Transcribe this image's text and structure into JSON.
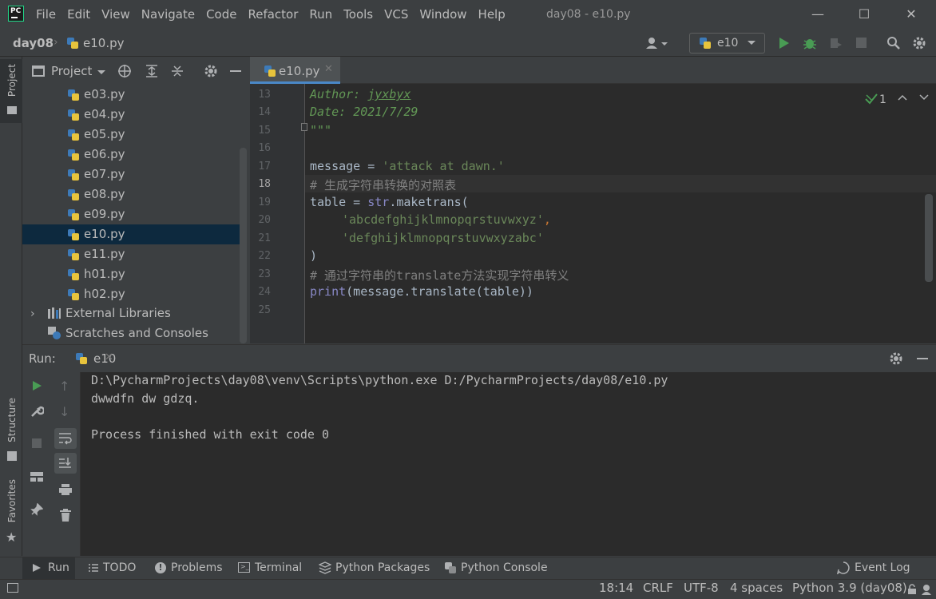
{
  "app": {
    "logo_text": "PC",
    "window_title": "day08 - e10.py",
    "menu": [
      "File",
      "Edit",
      "View",
      "Navigate",
      "Code",
      "Refactor",
      "Run",
      "Tools",
      "VCS",
      "Window",
      "Help"
    ]
  },
  "navbar": {
    "project": "day08",
    "file": "e10.py",
    "run_config": "e10"
  },
  "left_strip": {
    "project": "Project",
    "structure": "Structure",
    "favorites": "Favorites"
  },
  "project_panel": {
    "title": "Project",
    "files": [
      "e03.py",
      "e04.py",
      "e05.py",
      "e06.py",
      "e07.py",
      "e08.py",
      "e09.py",
      "e10.py",
      "e11.py",
      "h01.py",
      "h02.py"
    ],
    "selected": "e10.py",
    "external_libraries": "External Libraries",
    "scratches": "Scratches and Consoles"
  },
  "editor": {
    "tab": "e10.py",
    "inspection_count": "1",
    "lines": [
      {
        "n": "13",
        "text": "Author: jyxbyx"
      },
      {
        "n": "14",
        "text": "Date: 2021/7/29"
      },
      {
        "n": "15",
        "text": "\"\"\""
      },
      {
        "n": "16",
        "text": ""
      },
      {
        "n": "17",
        "text": "message = 'attack at dawn.'"
      },
      {
        "n": "18",
        "text": "# 生成字符串转换的对照表"
      },
      {
        "n": "19",
        "text": "table = str.maketrans("
      },
      {
        "n": "20",
        "text": "    'abcdefghijklmnopqrstuvwxyz',"
      },
      {
        "n": "21",
        "text": "    'defghijklmnopqrstuvwxyzabc'"
      },
      {
        "n": "22",
        "text": ")"
      },
      {
        "n": "23",
        "text": "# 通过字符串的translate方法实现字符串转义"
      },
      {
        "n": "24",
        "text": "print(message.translate(table))"
      },
      {
        "n": "25",
        "text": ""
      }
    ],
    "tokens": {
      "author_key": "Author: ",
      "author_val": "jyxbyx",
      "date_key": "Date: ",
      "date_val": "2021/7/29",
      "doc_close": "\"\"\"",
      "msg_var": "message = ",
      "msg_str": "'attack at dawn.'",
      "cmt1": "# 生成字符串转换的对照表",
      "table_var": "table = ",
      "str_builtin": "str",
      "maketrans": ".maketrans(",
      "arg1": "'abcdefghijklmnopqrstuvwxyz'",
      "comma": ",",
      "arg2": "'defghijklmnopqrstuvwxyzabc'",
      "close_paren": ")",
      "cmt2": "# 通过字符串的translate方法实现字符串转义",
      "print_builtin": "print",
      "print_rest": "(message.translate(table))"
    }
  },
  "run_panel": {
    "title": "Run:",
    "tab": "e10",
    "output": [
      "D:\\PycharmProjects\\day08\\venv\\Scripts\\python.exe D:/PycharmProjects/day08/e10.py",
      "dwwdfn dw gdzq.",
      "",
      "Process finished with exit code 0"
    ]
  },
  "tool_tabs": [
    "Run",
    "TODO",
    "Problems",
    "Terminal",
    "Python Packages",
    "Python Console",
    "Event Log"
  ],
  "status": {
    "position": "18:14",
    "line_sep": "CRLF",
    "encoding": "UTF-8",
    "indent": "4 spaces",
    "interpreter": "Python 3.9 (day08)"
  },
  "colors": {
    "accent": "#4a88c7",
    "run_green": "#499c54",
    "selection": "#0d293e"
  }
}
